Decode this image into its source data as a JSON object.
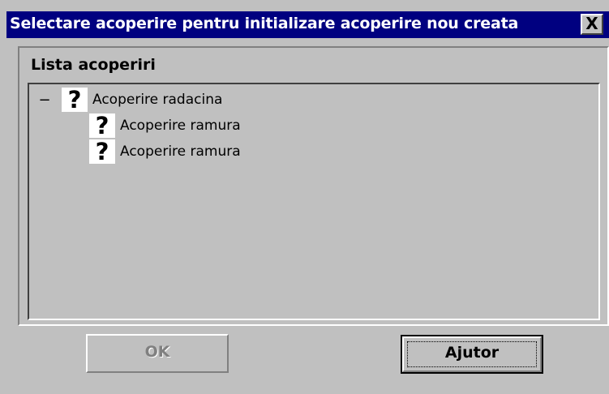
{
  "window": {
    "title": "Selectare acoperire pentru initializare acoperire nou creata",
    "close_label": "X"
  },
  "panel": {
    "title": "Lista acoperiri"
  },
  "tree": {
    "root": {
      "expander": "−",
      "icon": "question-mark-icon",
      "icon_glyph": "?",
      "label": "Acoperire radacina",
      "expanded": true
    },
    "children": [
      {
        "icon": "question-mark-icon",
        "icon_glyph": "?",
        "label": "Acoperire ramura"
      },
      {
        "icon": "question-mark-icon",
        "icon_glyph": "?",
        "label": "Acoperire ramura"
      }
    ]
  },
  "buttons": {
    "ok_label": "OK",
    "ok_enabled": false,
    "help_label": "Ajutor"
  },
  "colors": {
    "titlebar": "#000080",
    "face": "#c0c0c0",
    "disabled_text": "#808080"
  }
}
